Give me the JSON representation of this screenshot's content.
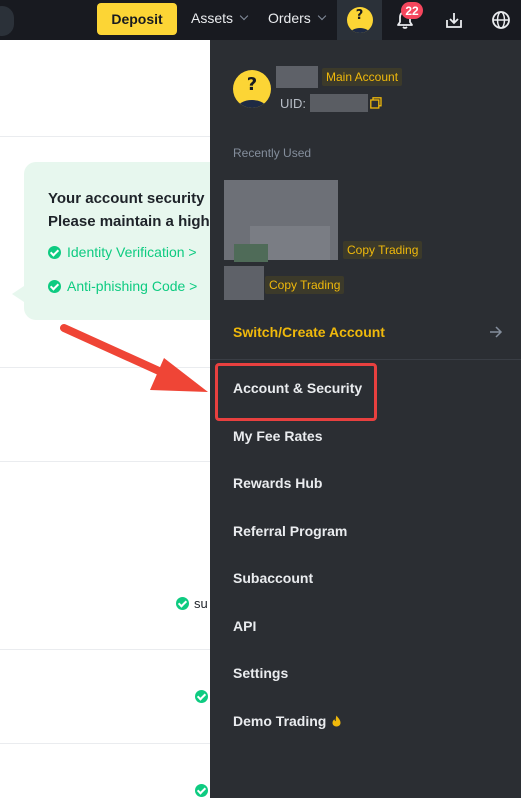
{
  "topbar": {
    "deposit_label": "Deposit",
    "nav": [
      {
        "label": "Assets"
      },
      {
        "label": "Orders"
      }
    ],
    "notification_count": "22"
  },
  "background_page": {
    "security_tip": {
      "line1": "Your account security",
      "line2": "Please maintain a high",
      "links": [
        {
          "label": "Identity Verification >"
        },
        {
          "label": "Anti-phishing Code >"
        }
      ]
    },
    "status_fragment": "su"
  },
  "dropdown": {
    "account_tag": "Main Account",
    "uid_label": "UID:",
    "recently_used_label": "Recently Used",
    "recent_tags": [
      "Copy Trading",
      "Copy Trading"
    ],
    "switch_label": "Switch/Create Account",
    "menu": [
      {
        "label": "Account & Security"
      },
      {
        "label": "My Fee Rates"
      },
      {
        "label": "Rewards Hub"
      },
      {
        "label": "Referral Program"
      },
      {
        "label": "Subaccount"
      },
      {
        "label": "API"
      },
      {
        "label": "Settings"
      },
      {
        "label": "Demo Trading"
      }
    ]
  },
  "colors": {
    "brand_yellow": "#fcd535",
    "accent_gold": "#f0b90b",
    "topbar_bg": "#181a20",
    "dropdown_bg": "#2b2e33",
    "success_green": "#0ecb81",
    "badge_red": "#f6465d",
    "annotation_red": "#e8403f"
  },
  "icons": [
    "bell-icon",
    "download-icon",
    "globe-icon",
    "copy-icon",
    "arrow-right-icon",
    "fire-icon",
    "check-circle-icon",
    "avatar-icon"
  ]
}
